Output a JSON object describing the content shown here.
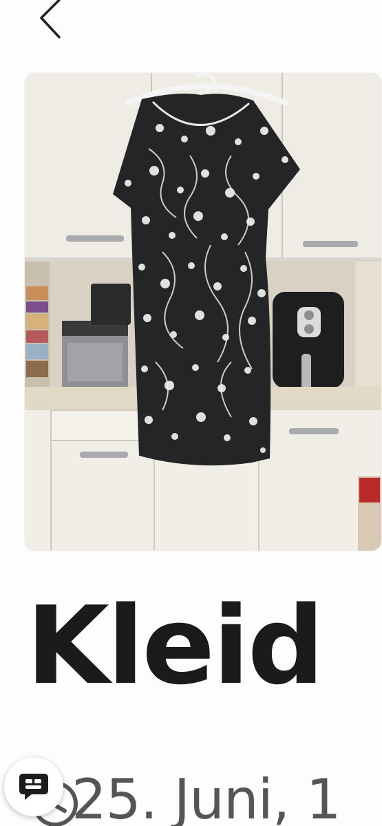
{
  "header": {
    "back_icon": "chevron-left-icon"
  },
  "listing": {
    "photo": {
      "subject": "black dress with white floral print on hanger",
      "icon": "photo"
    },
    "title": "Kleid",
    "date": "25. Juni, 1",
    "date_icon": "clock-icon"
  },
  "chat_fab": {
    "icon": "chat-bubble-icon"
  },
  "colors": {
    "title": "#1b1b1b",
    "date": "#555555",
    "background": "#fdfdfd"
  }
}
